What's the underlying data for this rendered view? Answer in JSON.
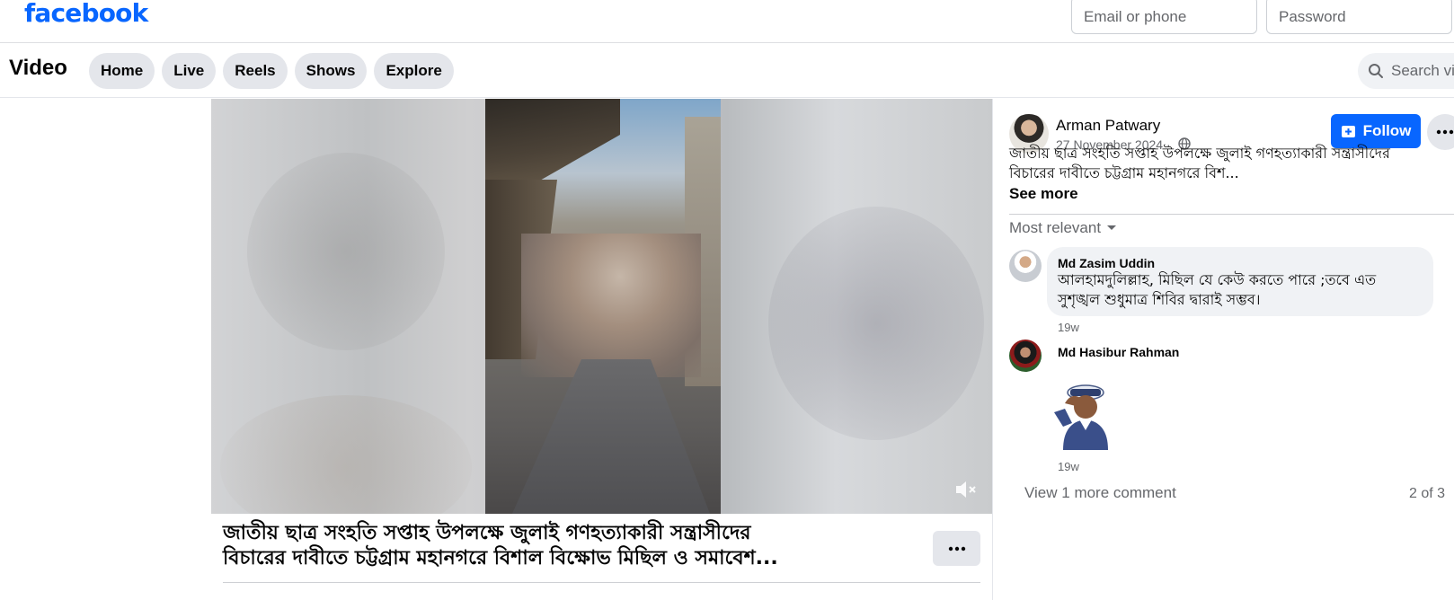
{
  "header": {
    "logo": "facebook",
    "email_placeholder": "Email or phone",
    "password_placeholder": "Password"
  },
  "video_nav": {
    "title": "Video",
    "tabs": [
      {
        "label": "Home"
      },
      {
        "label": "Live"
      },
      {
        "label": "Reels"
      },
      {
        "label": "Shows"
      },
      {
        "label": "Explore"
      }
    ],
    "search_placeholder": "Search vic"
  },
  "player": {
    "mute_icon": "speaker-muted-icon",
    "post_title_line1": "জাতীয় ছাত্র সংহতি সপ্তাহ উপলক্ষে জুলাই গণহত্যাকারী সন্ত্রাসীদের",
    "post_title_line2": "বিচারের দাবীতে চট্টগ্রাম মহানগরে বিশাল বিক্ষোভ মিছিল ও সমাবেশ...",
    "more_icon": "more-horizontal-icon"
  },
  "post": {
    "author": "Arman Patwary",
    "date": "27 November 2024 ·",
    "privacy_icon": "globe-icon",
    "follow_label": "Follow",
    "caption_line1": "জাতীয় ছাত্র সংহতি সপ্তাহ উপলক্ষে জুলাই গণহত্যাকারী সন্ত্রাসীদের",
    "caption_line2": "বিচারের দাবীতে চট্টগ্রাম মহানগরে বিশ...",
    "see_more": "See more",
    "sort_label": "Most relevant"
  },
  "comments": [
    {
      "name": "Md Zasim Uddin",
      "text_line1": "আলহামদুলিল্লাহ, মিছিল যে কেউ করতে পারে ;তবে এত",
      "text_line2": "সুশৃঙ্খল শুধুমাত্র শিবির দ্বারাই সম্ভব।",
      "time": "19w"
    },
    {
      "name": "Md Hasibur Rahman",
      "sticker": "saluting-officer-sticker",
      "time": "19w"
    }
  ],
  "comments_footer": {
    "view_more": "View 1 more comment",
    "count": "2 of 3"
  },
  "colors": {
    "brand": "#0866ff",
    "secondary_text": "#65676b",
    "button_gray": "#e4e6eb"
  }
}
